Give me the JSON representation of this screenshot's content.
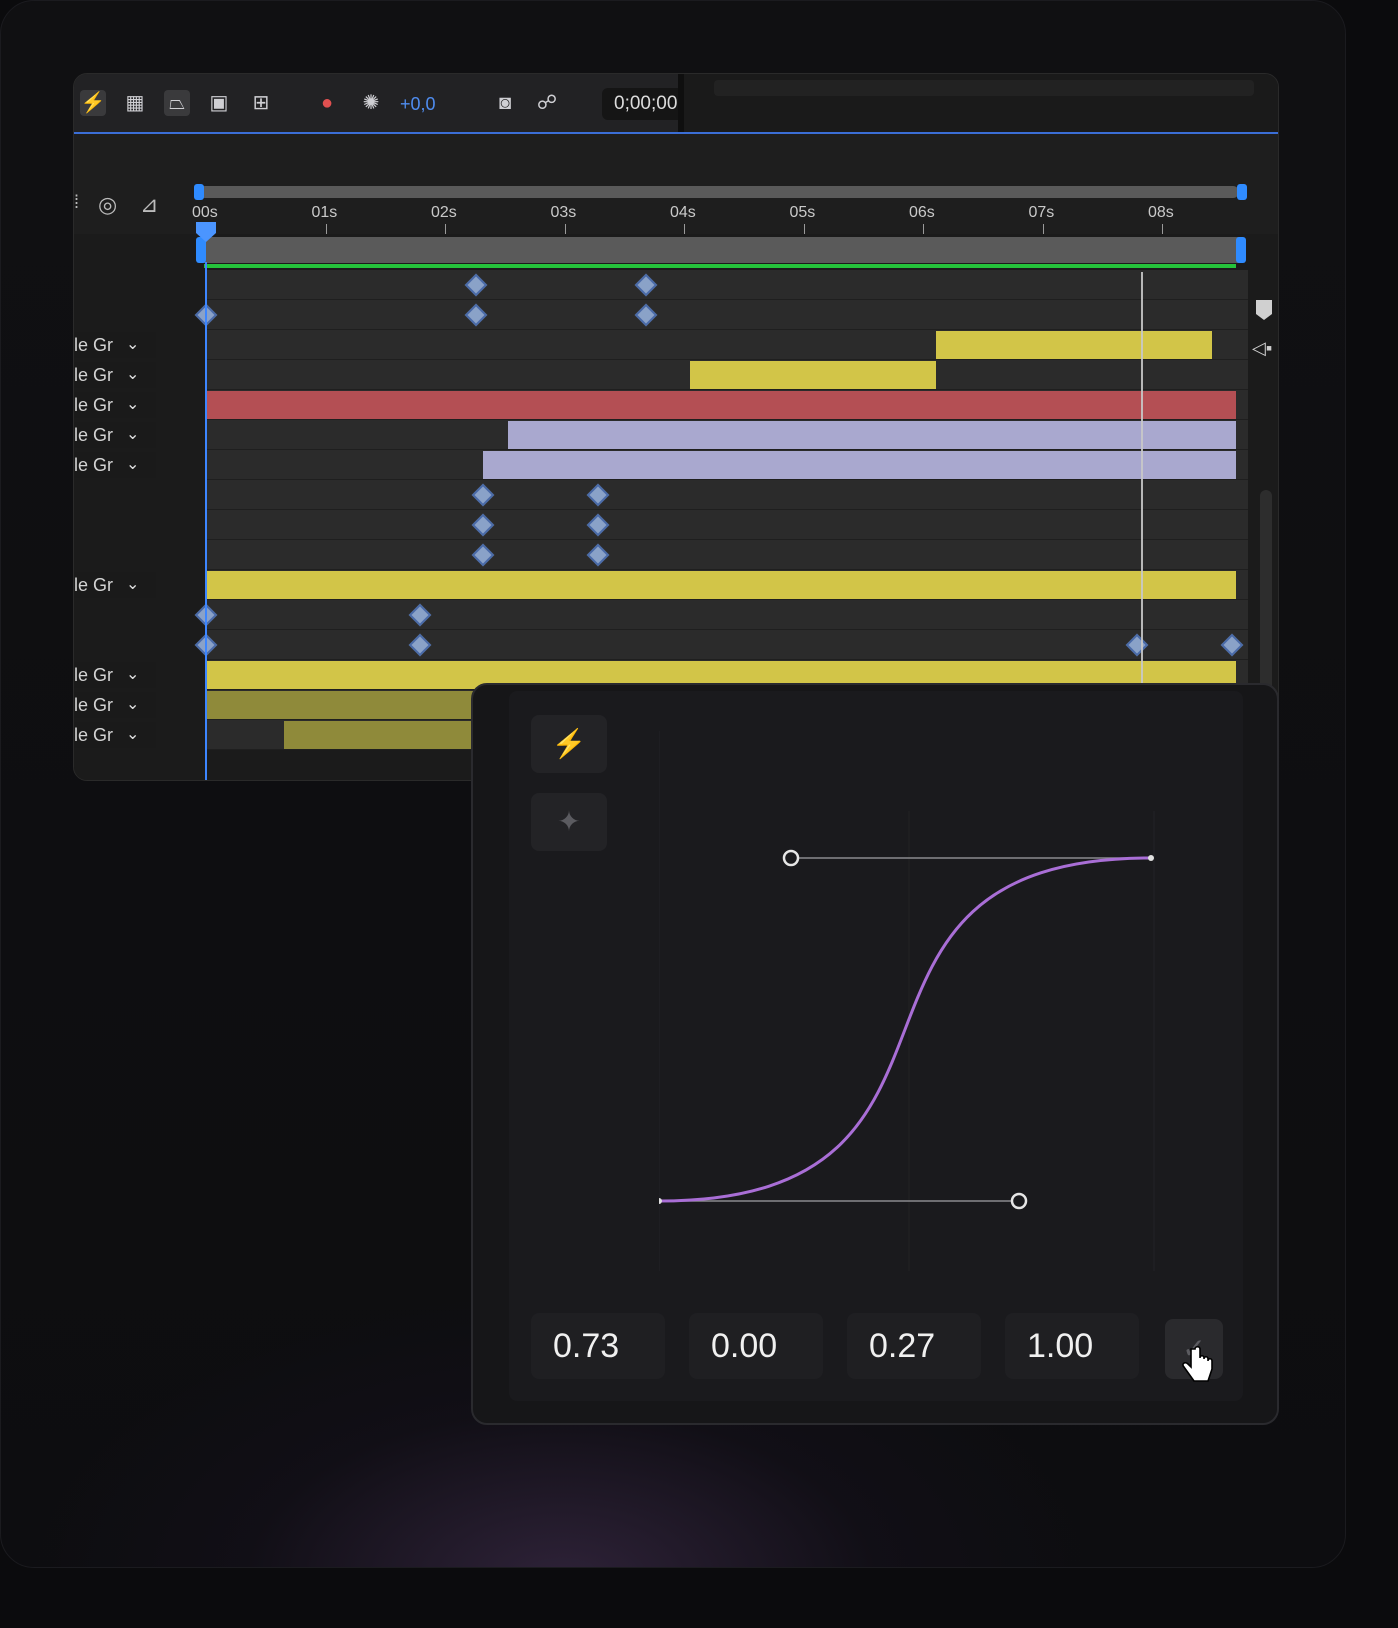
{
  "toolbar": {
    "exposure_value": "+0,0",
    "timecode": "0;00;00",
    "icons": [
      "render-preview-icon",
      "transparency-grid-icon",
      "mask-path-icon",
      "region-of-interest-icon",
      "safe-margins-icon",
      "color-channels-icon",
      "exposure-reset-icon",
      "snapshot-camera-icon",
      "show-snapshot-icon"
    ]
  },
  "timeline": {
    "ruler_ticks": [
      "00s",
      "01s",
      "02s",
      "03s",
      "04s",
      "05s",
      "06s",
      "07s",
      "08s"
    ],
    "layer_label": "le Gr",
    "colors": {
      "yellow": "#d2c548",
      "red": "#b44f54",
      "lavender": "#a9a8cf",
      "green": "#25c33b",
      "accent": "#2f8bff"
    }
  },
  "ease": {
    "values": [
      "0.73",
      "0.00",
      "0.27",
      "1.00"
    ],
    "buttons": [
      "bolt-icon",
      "sparkle-icon",
      "checkmark-icon"
    ],
    "curve_color": "#a96ed6"
  }
}
